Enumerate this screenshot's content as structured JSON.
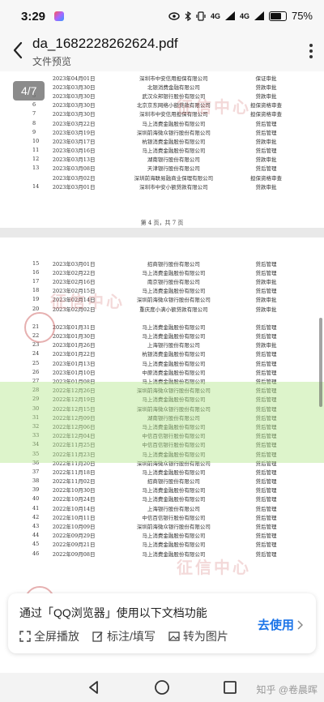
{
  "status": {
    "time": "3:29",
    "network": "4G",
    "network2": "4G",
    "battery": "75%"
  },
  "header": {
    "file_name": "da_1682228262624.pdf",
    "subtitle": "文件预览"
  },
  "viewer": {
    "page_indicator": "4/7",
    "page_a_rows": [
      [
        "",
        "2023年04月01日",
        "深圳市中安信用担保有限公司",
        "保证审批"
      ],
      [
        "",
        "2023年03月30日",
        "北银消费金融有限公司",
        "贷款审批"
      ],
      [
        "5",
        "2023年03月30日",
        "武汉众邦银行股份有限公司",
        "贷款审批"
      ],
      [
        "6",
        "2023年03月30日",
        "北京京东网络小额贷款有限公司",
        "担保资格审查"
      ],
      [
        "7",
        "2023年03月30日",
        "深圳市中安信用担保有限公司",
        "担保资格审查"
      ],
      [
        "8",
        "2023年03月22日",
        "马上消费金融股份有限公司",
        "贷后管理"
      ],
      [
        "9",
        "2023年03月19日",
        "深圳前海微众银行股份有限公司",
        "贷后管理"
      ],
      [
        "10",
        "2023年03月17日",
        "杭银消费金融股份有限公司",
        "贷款审批"
      ],
      [
        "11",
        "2023年03月16日",
        "马上消费金融股份有限公司",
        "贷后管理"
      ],
      [
        "12",
        "2023年03月13日",
        "湖南银行股份有限公司",
        "贷款审批"
      ],
      [
        "13",
        "2023年03月08日",
        "天津银行股份有限公司",
        "贷后管理"
      ],
      [
        "",
        "2023年03月02日",
        "深圳前海联易融商业保理有限公司",
        "担保资格审查"
      ],
      [
        "14",
        "2023年03月01日",
        "深圳市中安小额贷款有限公司",
        "贷款审批"
      ]
    ],
    "page_a_footer": "第 4 页，共 7 页",
    "page_b_rows": [
      [
        "15",
        "2023年03月01日",
        "招商银行股份有限公司",
        "贷后管理"
      ],
      [
        "16",
        "2023年02月22日",
        "马上消费金融股份有限公司",
        "贷后管理"
      ],
      [
        "17",
        "2023年02月16日",
        "南京银行股份有限公司",
        "贷款审批"
      ],
      [
        "18",
        "2023年02月15日",
        "马上消费金融股份有限公司",
        "贷后管理"
      ],
      [
        "19",
        "2023年02月14日",
        "深圳前海微众银行股份有限公司",
        "贷款审批"
      ],
      [
        "20",
        "2023年02月02日",
        "重庆度小满小额贷款有限公司",
        "贷款审批"
      ],
      [
        "",
        "",
        "",
        ""
      ],
      [
        "21",
        "2023年01月31日",
        "马上消费金融股份有限公司",
        "贷后管理"
      ],
      [
        "22",
        "2023年01月30日",
        "马上消费金融股份有限公司",
        "贷后管理"
      ],
      [
        "23",
        "2023年01月26日",
        "上海银行股份有限公司",
        "贷款审批"
      ],
      [
        "24",
        "2023年01月22日",
        "杭银消费金融股份有限公司",
        "贷后管理"
      ],
      [
        "25",
        "2023年01月13日",
        "马上消费金融股份有限公司",
        "贷后管理"
      ],
      [
        "26",
        "2023年01月10日",
        "中原消费金融股份有限公司",
        "贷后管理"
      ],
      [
        "27",
        "2023年01月08日",
        "马上消费金融股份有限公司",
        "贷后管理"
      ],
      [
        "28",
        "2022年12月26日",
        "深圳前海微众银行股份有限公司",
        "贷后管理"
      ],
      [
        "29",
        "2022年12月19日",
        "马上消费金融股份有限公司",
        "贷后管理"
      ],
      [
        "30",
        "2022年12月15日",
        "深圳前海微众银行股份有限公司",
        "贷后管理"
      ],
      [
        "31",
        "2022年12月09日",
        "湖南银行股份有限公司",
        "贷后管理"
      ],
      [
        "32",
        "2022年12月06日",
        "马上消费金融股份有限公司",
        "贷后管理"
      ],
      [
        "33",
        "2022年12月04日",
        "中信百信银行股份有限公司",
        "贷后管理"
      ],
      [
        "34",
        "2022年11月25日",
        "中信百信银行股份有限公司",
        "贷后管理"
      ],
      [
        "35",
        "2022年11月23日",
        "马上消费金融股份有限公司",
        "贷后管理"
      ],
      [
        "36",
        "2022年11月20日",
        "深圳前海微众银行股份有限公司",
        "贷后管理"
      ],
      [
        "37",
        "2022年11月18日",
        "马上消费金融股份有限公司",
        "贷后管理"
      ],
      [
        "38",
        "2022年11月02日",
        "招商银行股份有限公司",
        "贷后管理"
      ],
      [
        "39",
        "2022年10月30日",
        "马上消费金融股份有限公司",
        "贷后管理"
      ],
      [
        "40",
        "2022年10月24日",
        "马上消费金融股份有限公司",
        "贷后管理"
      ],
      [
        "41",
        "2022年10月14日",
        "上海银行股份有限公司",
        "贷后管理"
      ],
      [
        "42",
        "2022年10月11日",
        "中信百信银行股份有限公司",
        "贷后管理"
      ],
      [
        "43",
        "2022年10月09日",
        "深圳前海微众银行股份有限公司",
        "贷后管理"
      ],
      [
        "44",
        "2022年09月29日",
        "马上消费金融股份有限公司",
        "贷后管理"
      ],
      [
        "45",
        "2022年09月21日",
        "马上消费金融股份有限公司",
        "贷后管理"
      ],
      [
        "46",
        "2022年09月08日",
        "马上消费金融股份有限公司",
        "贷后管理"
      ]
    ],
    "watermark_center": "征信中心",
    "watermark_side": "征信中心"
  },
  "prompt": {
    "text": "通过「QQ浏览器」使用以下文档功能",
    "features": [
      "全屏播放",
      "标注/填写",
      "转为图片"
    ],
    "go_label": "去使用"
  },
  "navbar": {
    "watermark": "知乎 @卷晨晖"
  },
  "colors": {
    "accent": "#1a73e8",
    "banner": "#b4e68c",
    "stamp": "#c85050"
  }
}
